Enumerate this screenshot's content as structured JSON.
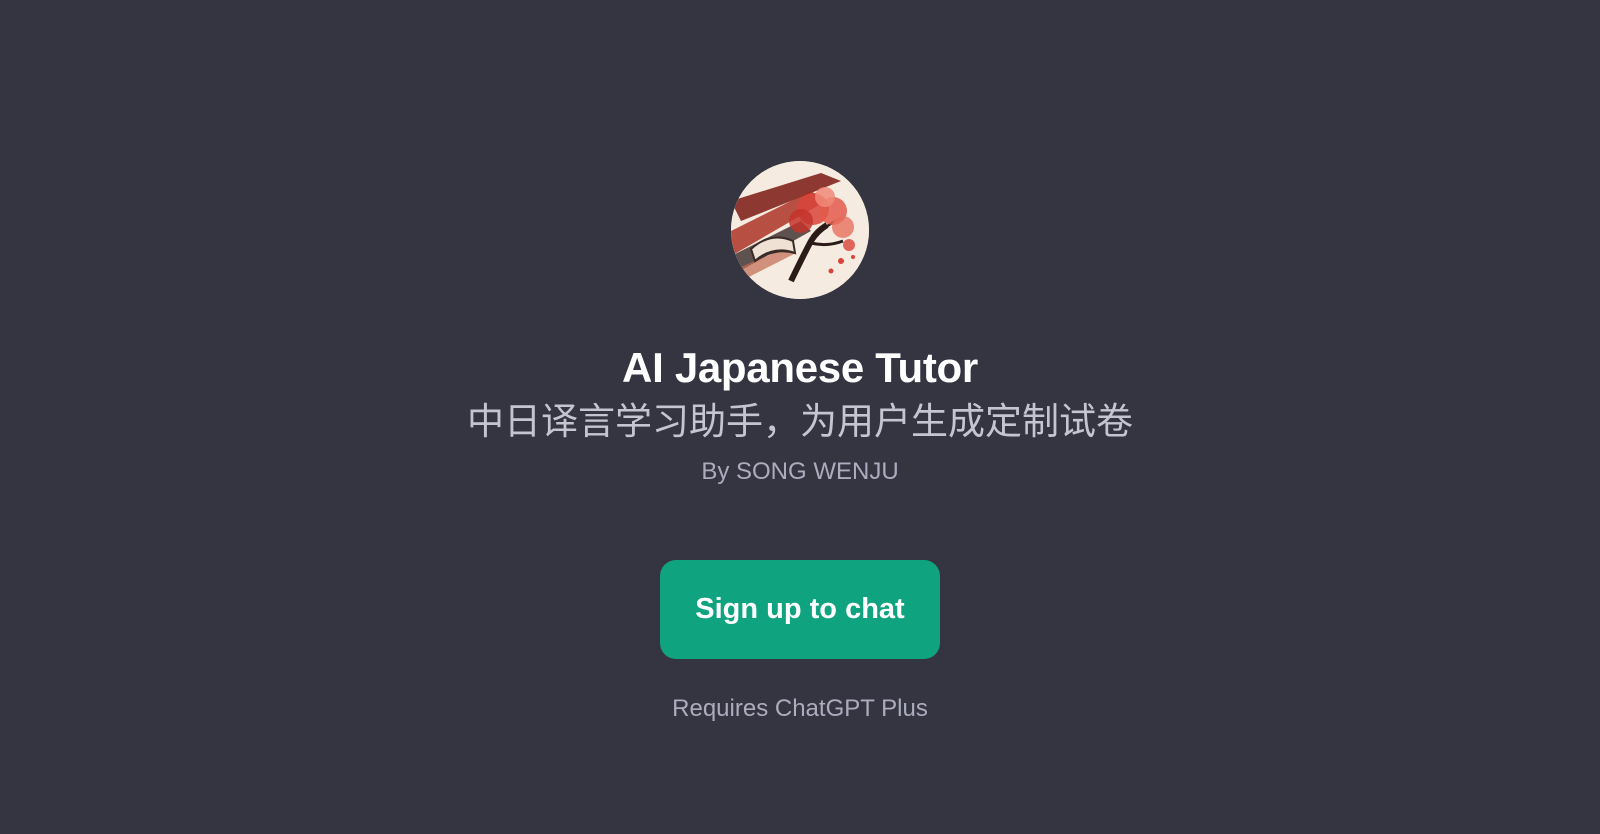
{
  "gpt": {
    "avatar_icon": "cherry-blossom-great-wall-icon",
    "title": "AI Japanese Tutor",
    "description": "中日译言学习助手，为用户生成定制试卷",
    "author": "By SONG WENJU"
  },
  "cta": {
    "label": "Sign up to chat",
    "color": "#10a37f"
  },
  "footer": {
    "requires": "Requires ChatGPT Plus"
  },
  "theme": {
    "background": "#343541"
  }
}
